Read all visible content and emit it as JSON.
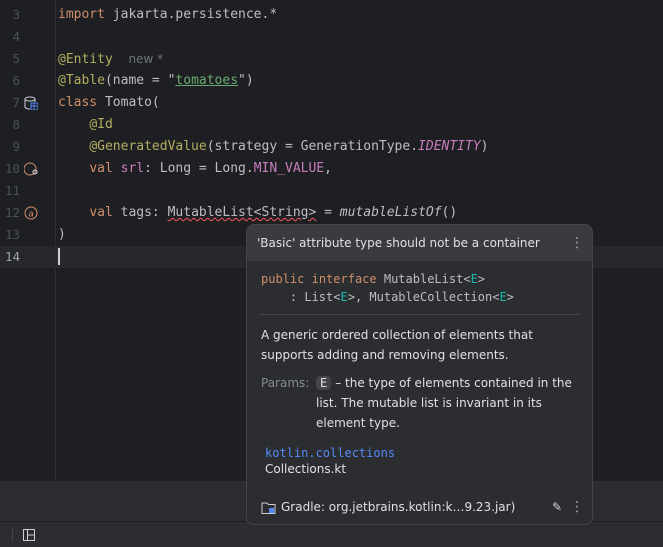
{
  "editor": {
    "lines": [
      {
        "n": "3",
        "parts": [
          [
            "kw",
            "import"
          ],
          [
            "",
            " jakarta.persistence.*"
          ]
        ]
      },
      {
        "n": "4",
        "parts": []
      },
      {
        "n": "5",
        "parts": [
          [
            "an",
            "@Entity"
          ]
        ],
        "hint": "new *"
      },
      {
        "n": "6",
        "parts": [
          [
            "an",
            "@Table"
          ],
          [
            "",
            "(name = "
          ],
          [
            "",
            "\""
          ],
          [
            "str",
            "tomatoes"
          ],
          [
            "",
            "\")"
          ]
        ]
      },
      {
        "n": "7",
        "parts": [
          [
            "kw",
            "class"
          ],
          [
            "",
            " Tomato("
          ]
        ],
        "icon": "entity-table-icon"
      },
      {
        "n": "8",
        "parts": [
          [
            "",
            "    "
          ],
          [
            "an",
            "@Id"
          ]
        ]
      },
      {
        "n": "9",
        "parts": [
          [
            "",
            "    "
          ],
          [
            "an",
            "@GeneratedValue"
          ],
          [
            "",
            "(strategy = GenerationType."
          ],
          [
            "pur it",
            "IDENTITY"
          ],
          [
            "",
            ")"
          ]
        ]
      },
      {
        "n": "10",
        "parts": [
          [
            "",
            "    "
          ],
          [
            "kw",
            "val"
          ],
          [
            "",
            " "
          ],
          [
            "pur",
            "srl"
          ],
          [
            "",
            ": Long = Long."
          ],
          [
            "pur",
            "MIN_VALUE"
          ],
          [
            "",
            ","
          ]
        ],
        "icon": "id-column-icon"
      },
      {
        "n": "11",
        "parts": []
      },
      {
        "n": "12",
        "parts": [
          [
            "",
            "    "
          ],
          [
            "kw",
            "val"
          ],
          [
            "",
            " tags: "
          ],
          [
            "err",
            "MutableList<String>"
          ],
          [
            "",
            " = "
          ],
          [
            "it",
            "mutableListOf"
          ],
          [
            "",
            "()"
          ]
        ],
        "icon": "attribute-icon"
      },
      {
        "n": "13",
        "parts": [
          [
            "",
            ")"
          ]
        ]
      },
      {
        "n": "14",
        "parts": [],
        "current": true
      }
    ]
  },
  "popup": {
    "title": "'Basic' attribute type should not be a container",
    "sig_kw1": "public",
    "sig_kw2": "interface",
    "sig_name": "MutableList<",
    "sig_tp": "E",
    "sig_l2a": "    : List<",
    "sig_l2b": ">, MutableCollection<",
    "description": "A generic ordered collection of elements that supports adding and removing elements.",
    "params_label": "Params:",
    "param_name": "E",
    "param_desc": "– the type of elements contained in the list. The mutable list is invariant in its element type.",
    "package": "kotlin.collections",
    "file": "Collections.kt",
    "library": "Gradle: org.jetbrains.kotlin:k…9.23.jar)"
  }
}
